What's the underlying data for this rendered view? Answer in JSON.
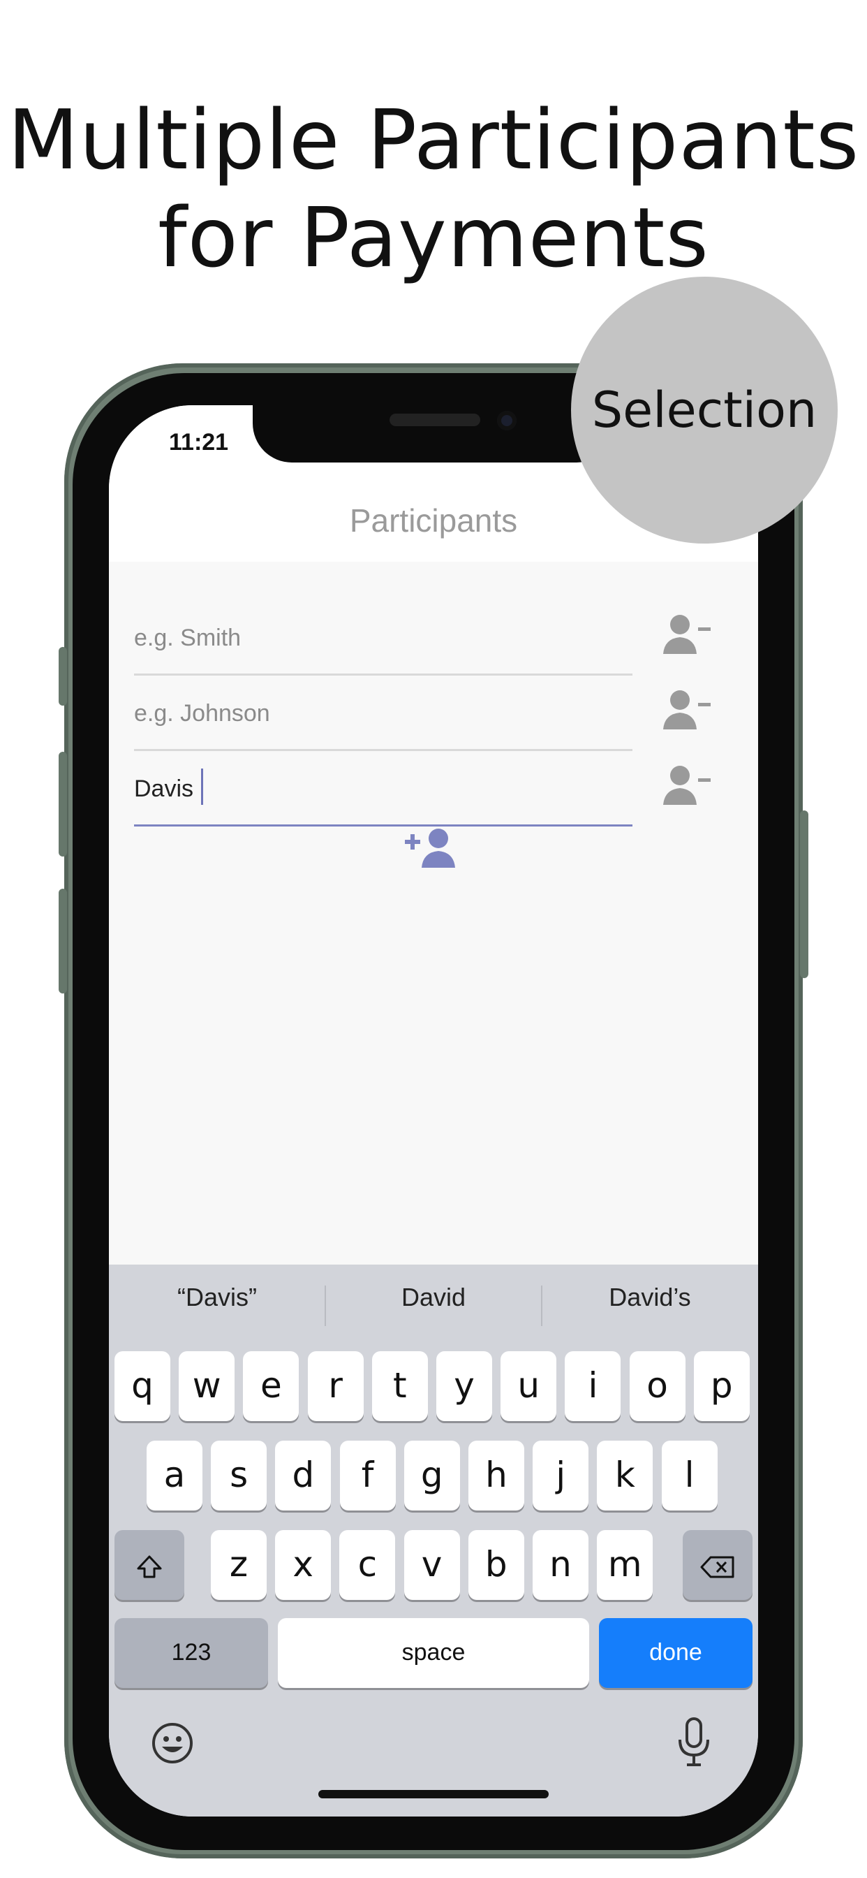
{
  "headline": {
    "line1": "Multiple Participants",
    "line2": "for Payments"
  },
  "badge": {
    "label": "Selection"
  },
  "status": {
    "time": "11:21"
  },
  "nav": {
    "title": "Participants"
  },
  "participants": [
    {
      "value": "",
      "placeholder": "e.g. Smith"
    },
    {
      "value": "",
      "placeholder": "e.g. Johnson"
    },
    {
      "value": "Davis",
      "placeholder": ""
    }
  ],
  "icons": {
    "remove": "person-remove-icon",
    "add": "person-add-icon",
    "shift": "shift-icon",
    "delete": "backspace-icon",
    "emoji": "emoji-icon",
    "mic": "microphone-icon"
  },
  "keyboard": {
    "suggestions": [
      "“Davis”",
      "David",
      "David’s"
    ],
    "row1": [
      "q",
      "w",
      "e",
      "r",
      "t",
      "y",
      "u",
      "i",
      "o",
      "p"
    ],
    "row2": [
      "a",
      "s",
      "d",
      "f",
      "g",
      "h",
      "j",
      "k",
      "l"
    ],
    "row3": [
      "z",
      "x",
      "c",
      "v",
      "b",
      "n",
      "m"
    ],
    "numbers_label": "123",
    "space_label": "space",
    "done_label": "done"
  },
  "colors": {
    "accent": "#7d84c1",
    "icon_grey": "#9a9a9a",
    "done_blue": "#157efb",
    "phone_frame": "#6f7f73",
    "badge": "#c4c4c4"
  }
}
